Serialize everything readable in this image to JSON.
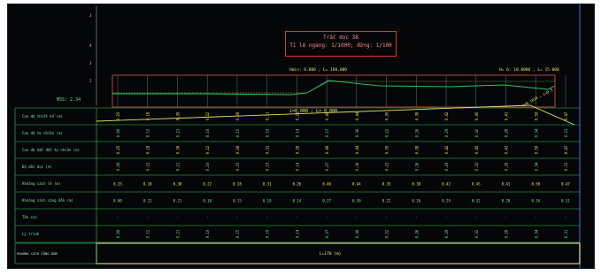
{
  "header": {
    "line1": "Trắc dọc 38",
    "line2": "Tỉ lệ ngang: 1/1000; đứng: 1/100"
  },
  "profile": {
    "datum_label": "MSS: 2.34",
    "top_left_label": "Hmin: 0.000 ; L= 160.000",
    "top_right_label": "H= 6: 10.0000 ; L= 15.000",
    "slope_label": "i=0.000 ; L= 0.000",
    "slope_label_right": "i=0.1024 ; L=9.5"
  },
  "axis_ticks": [
    "3",
    "4",
    "3",
    "2"
  ],
  "rows": [
    "Cao độ thiết kế (m)",
    "Cao độ tự nhiên (m)",
    "Cao độ mặt đất tự nhiên (m)",
    "Độ dốc dọc (%)",
    "Khoảng cách lẻ (m)",
    "Khoảng cách cộng dồn (m)",
    "Tên cọc",
    "Lý trình"
  ],
  "bottom_row": {
    "label": "KHOẢNG CÁCH CỘNG DỒN",
    "value": "L=170 (m)"
  },
  "colors": {
    "background": "#050608",
    "grid": "#2fc45a",
    "profile_natural": "#2fc45a",
    "profile_top": "#e05050",
    "text_yellow": "#f0e060",
    "frame_blue": "#3a4aa0"
  },
  "stations": [
    [
      "0.25",
      "0.00"
    ],
    [
      "0.18",
      "0.12"
    ],
    [
      "0.30",
      "0.21"
    ],
    [
      "0.22",
      "0.10"
    ],
    [
      "0.28",
      "0.15"
    ],
    [
      "0.31",
      "0.19"
    ],
    [
      "0.26",
      "0.14"
    ],
    [
      "0.40",
      "0.27"
    ],
    [
      "0.44",
      "0.30"
    ],
    [
      "0.35",
      "0.22"
    ],
    [
      "0.38",
      "0.26"
    ],
    [
      "0.42",
      "0.29"
    ],
    [
      "0.45",
      "0.32"
    ],
    [
      "0.41",
      "0.28"
    ],
    [
      "0.50",
      "0.34"
    ],
    [
      "0.47",
      "0.31"
    ]
  ]
}
